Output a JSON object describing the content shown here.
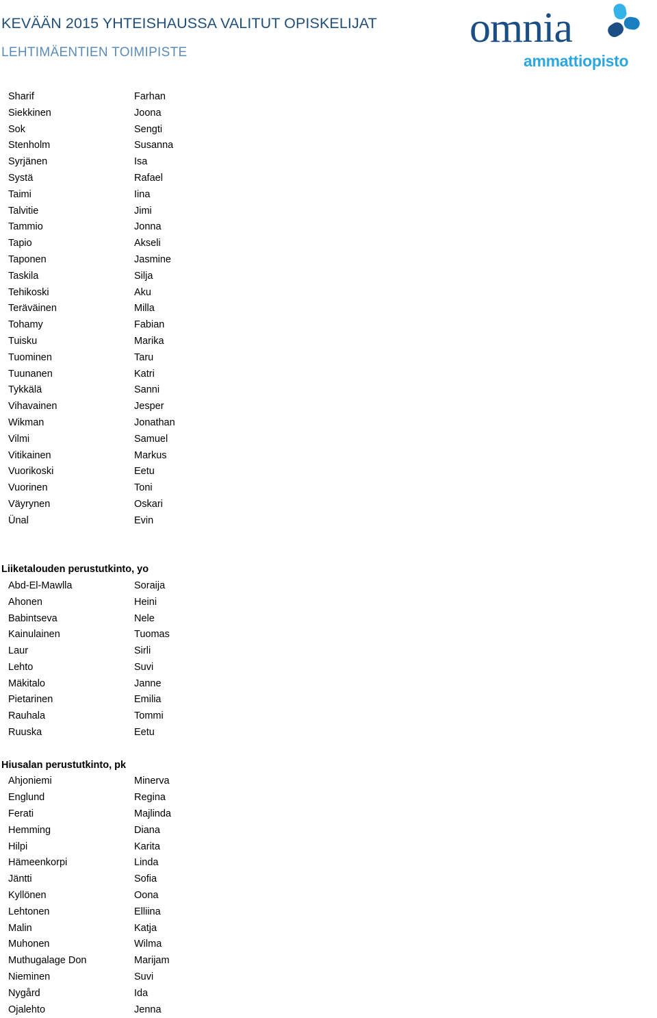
{
  "header": {
    "title": "KEVÄÄN 2015 YHTEISHAUSSA VALITUT OPISKELIJAT",
    "subtitle": "LEHTIMÄENTIEN TOIMIPISTE",
    "title_color": "#1f4e79",
    "subtitle_color": "#5b8cb5",
    "logo": {
      "wordmark": "omnia",
      "tagline": "ammattiopisto",
      "wordmark_color": "#1b4f84",
      "tagline_color": "#2ba6de",
      "mark_colors": {
        "petal_light": "#35b3e8",
        "petal_mid": "#1a7fc1",
        "petal_dark": "#1b4f84"
      }
    }
  },
  "sections": [
    {
      "heading": null,
      "rows": [
        {
          "last": "Sharif",
          "first": "Farhan"
        },
        {
          "last": "Siekkinen",
          "first": "Joona"
        },
        {
          "last": "Sok",
          "first": "Sengti"
        },
        {
          "last": "Stenholm",
          "first": "Susanna"
        },
        {
          "last": "Syrjänen",
          "first": "Isa"
        },
        {
          "last": "Systä",
          "first": "Rafael"
        },
        {
          "last": "Taimi",
          "first": "Iina"
        },
        {
          "last": "Talvitie",
          "first": "Jimi"
        },
        {
          "last": "Tammio",
          "first": "Jonna"
        },
        {
          "last": "Tapio",
          "first": "Akseli"
        },
        {
          "last": "Taponen",
          "first": "Jasmine"
        },
        {
          "last": "Taskila",
          "first": "Silja"
        },
        {
          "last": "Tehikoski",
          "first": "Aku"
        },
        {
          "last": "Teräväinen",
          "first": "Milla"
        },
        {
          "last": "Tohamy",
          "first": "Fabian"
        },
        {
          "last": "Tuisku",
          "first": "Marika"
        },
        {
          "last": "Tuominen",
          "first": "Taru"
        },
        {
          "last": "Tuunanen",
          "first": "Katri"
        },
        {
          "last": "Tykkälä",
          "first": "Sanni"
        },
        {
          "last": "Vihavainen",
          "first": "Jesper"
        },
        {
          "last": "Wikman",
          "first": "Jonathan"
        },
        {
          "last": "Vilmi",
          "first": "Samuel"
        },
        {
          "last": "Vitikainen",
          "first": "Markus"
        },
        {
          "last": "Vuorikoski",
          "first": "Eetu"
        },
        {
          "last": "Vuorinen",
          "first": "Toni"
        },
        {
          "last": "Väyrynen",
          "first": "Oskari"
        },
        {
          "last": "Ünal",
          "first": "Evin"
        }
      ]
    },
    {
      "heading": "Liiketalouden perustutkinto, yo",
      "rows": [
        {
          "last": "Abd-El-Mawlla",
          "first": "Soraija"
        },
        {
          "last": "Ahonen",
          "first": "Heini"
        },
        {
          "last": "Babintseva",
          "first": "Nele"
        },
        {
          "last": "Kainulainen",
          "first": "Tuomas"
        },
        {
          "last": "Laur",
          "first": "Sirli"
        },
        {
          "last": "Lehto",
          "first": "Suvi"
        },
        {
          "last": "Mäkitalo",
          "first": "Janne"
        },
        {
          "last": "Pietarinen",
          "first": "Emilia"
        },
        {
          "last": "Rauhala",
          "first": "Tommi"
        },
        {
          "last": "Ruuska",
          "first": "Eetu"
        }
      ]
    },
    {
      "heading": "Hiusalan perustutkinto, pk",
      "rows": [
        {
          "last": "Ahjoniemi",
          "first": "Minerva"
        },
        {
          "last": "Englund",
          "first": "Regina"
        },
        {
          "last": "Ferati",
          "first": "Majlinda"
        },
        {
          "last": "Hemming",
          "first": "Diana"
        },
        {
          "last": "Hilpi",
          "first": "Karita"
        },
        {
          "last": "Hämeenkorpi",
          "first": "Linda"
        },
        {
          "last": "Jäntti",
          "first": "Sofia"
        },
        {
          "last": "Kyllönen",
          "first": "Oona"
        },
        {
          "last": "Lehtonen",
          "first": "Elliina"
        },
        {
          "last": "Malin",
          "first": "Katja"
        },
        {
          "last": "Muhonen",
          "first": "Wilma"
        },
        {
          "last": "Muthugalage Don",
          "first": "Marijam"
        },
        {
          "last": "Nieminen",
          "first": "Suvi"
        },
        {
          "last": "Nygård",
          "first": "Ida"
        },
        {
          "last": "Ojalehto",
          "first": "Jenna"
        }
      ]
    }
  ]
}
